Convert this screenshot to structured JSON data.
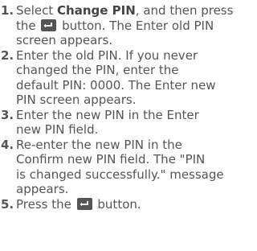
{
  "instructions": {
    "steps": [
      {
        "number": "1.",
        "l1_pre": "Select ",
        "l1_bold": "Change PIN",
        "l1_post": ", and then press",
        "l2_pre": "the ",
        "l2_post": " button. The Enter old PIN",
        "l3": "screen appears."
      },
      {
        "number": "2.",
        "l1": "Enter the old PIN. If you never",
        "l2": "changed the PIN, enter the",
        "l3": "default PIN: 0000. The Enter new",
        "l4": "PIN screen appears."
      },
      {
        "number": "3.",
        "l1": "Enter the new PIN in the Enter",
        "l2": "new PIN field."
      },
      {
        "number": "4.",
        "l1": "Re-enter the new PIN in the",
        "l2": "Confirm new PIN field. The \"PIN",
        "l3": "is changed successfully.\" message",
        "l4": "appears."
      },
      {
        "number": "5.",
        "l1_pre": "Press the ",
        "l1_post": " button."
      }
    ],
    "icon": "enter-button-icon"
  }
}
